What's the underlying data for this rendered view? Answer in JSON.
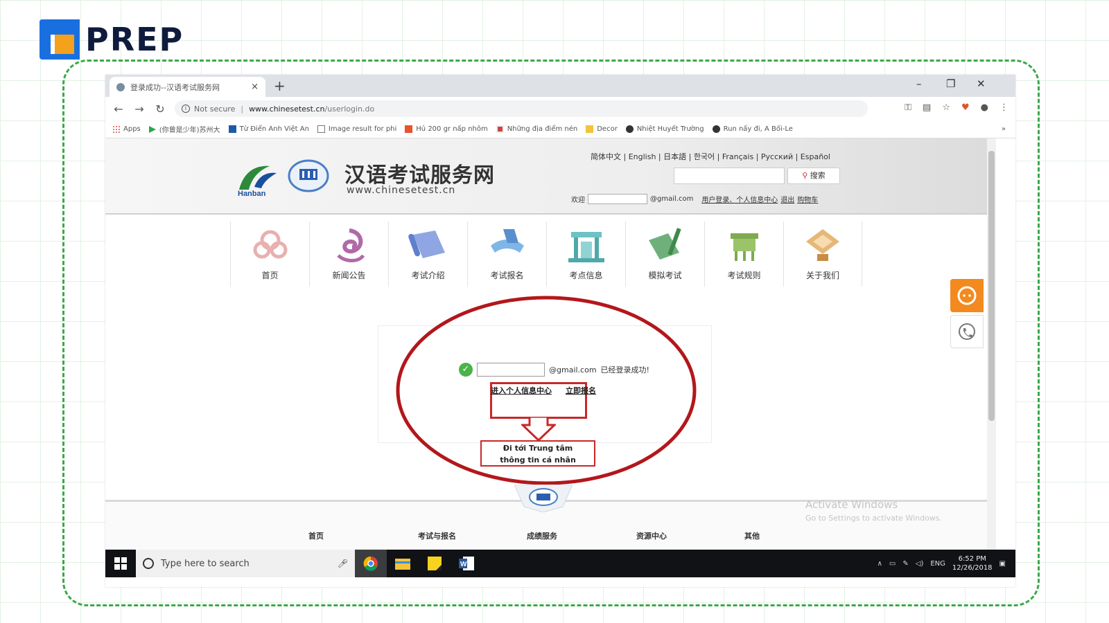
{
  "brand": {
    "name": "PREP"
  },
  "browser": {
    "tab_title": "登录成功--汉语考试服务网",
    "tab_close": "×",
    "new_tab": "+",
    "window_controls": [
      "–",
      "❐",
      "✕"
    ],
    "not_secure": "Not secure",
    "separator": "|",
    "url_host": "www.chinesetest.cn",
    "url_path": "/userlogin.do",
    "bookmarks": [
      "Apps",
      "(你曾是少年)苏州大",
      "Từ Điển Anh Việt An",
      "Image result for phi",
      "Hủ 200 gr nấp nhôm",
      "Những địa điểm nén",
      "Decor",
      "Nhiệt Huyết Trường",
      "Run nấy đi, A Bối-Le"
    ],
    "bookmarks_more": "»"
  },
  "site": {
    "title": "汉语考试服务网",
    "url": "www.chinesetest.cn",
    "logo_caption": "Hanban",
    "languages": "简体中文 | English | 日本語 | 한국어 | Français | Русский | Español",
    "search_button": "搜索",
    "welcome_label": "欢迎",
    "welcome_email_suffix": "@gmail.com",
    "user_links": [
      "用户登录、个人信息中心",
      "退出",
      "购物车"
    ],
    "nav": [
      "首页",
      "新闻公告",
      "考试介绍",
      "考试报名",
      "考点信息",
      "模拟考试",
      "考试规则",
      "关于我们"
    ],
    "login": {
      "email_suffix": "@gmail.com",
      "success_text": "已经登录成功!",
      "personal_center_link": "进入个人信息中心",
      "register_link": "立即报名"
    },
    "annotation": "Đi tới Trung tâm\nthông tin cá nhân",
    "annotation_line1": "Đi tới Trung tâm",
    "annotation_line2": "thông tin cá nhân",
    "footer_nav": [
      "首页",
      "考试与报名",
      "成绩服务",
      "资源中心",
      "其他"
    ]
  },
  "watermark": {
    "line1": "Activate Windows",
    "line2": "Go to Settings to activate Windows."
  },
  "taskbar": {
    "search_placeholder": "Type here to search",
    "lang": "ENG",
    "time": "6:52 PM",
    "date": "12/26/2018"
  },
  "colors": {
    "frame_green": "#3aa84a",
    "brand_blue": "#1a6fe0",
    "brand_orange": "#f4a11c",
    "highlight_red": "#c92727",
    "widget_orange": "#f28a1f"
  }
}
